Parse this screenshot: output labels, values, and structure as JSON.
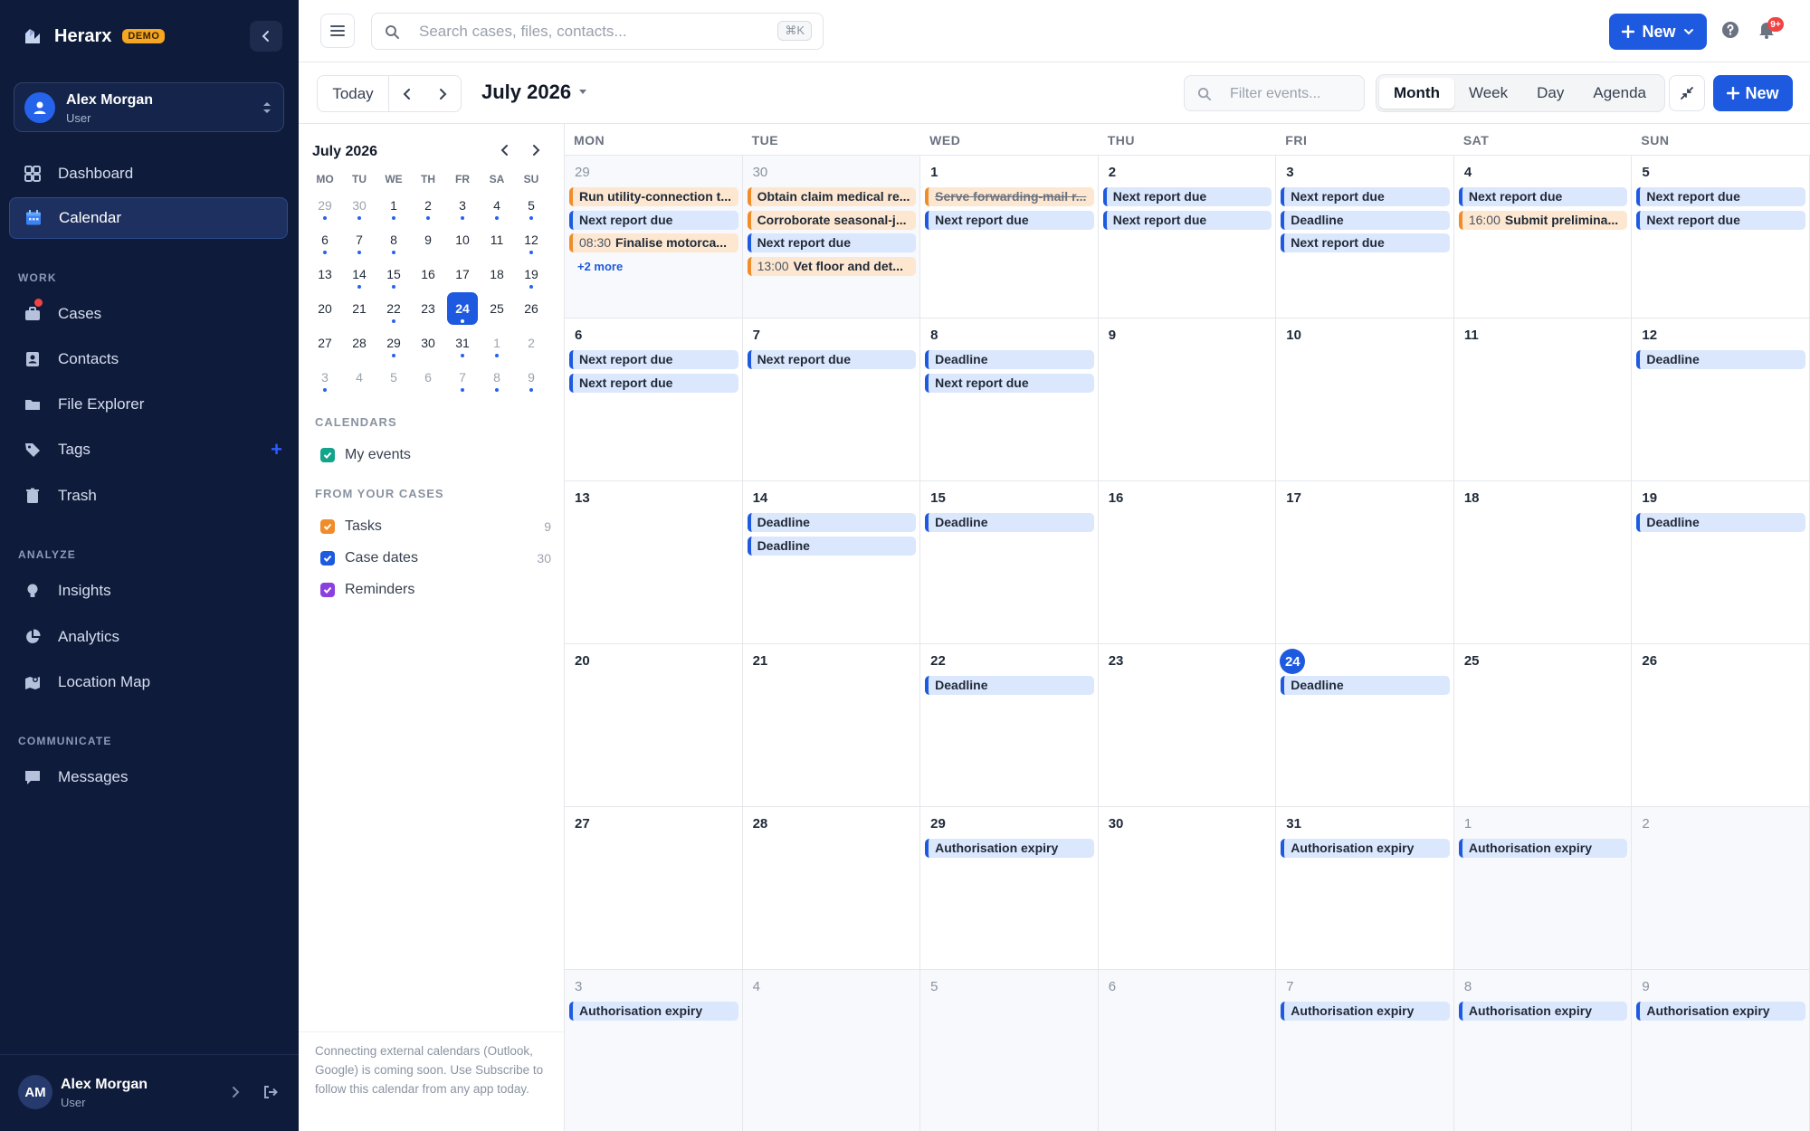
{
  "brand": {
    "name": "Herarx",
    "badge": "DEMO"
  },
  "user": {
    "name": "Alex Morgan",
    "role": "User",
    "initials": "AM"
  },
  "nav": {
    "dashboard": "Dashboard",
    "calendar": "Calendar",
    "work_label": "WORK",
    "cases": "Cases",
    "contacts": "Contacts",
    "file_explorer": "File Explorer",
    "tags": "Tags",
    "tags_add": "+",
    "trash": "Trash",
    "analyze_label": "ANALYZE",
    "insights": "Insights",
    "analytics": "Analytics",
    "location_map": "Location Map",
    "communicate_label": "COMMUNICATE",
    "messages": "Messages"
  },
  "topbar": {
    "search_placeholder": "Search cases, files, contacts...",
    "shortcut": "⌘K",
    "new_label": "New",
    "notif_badge": "9+"
  },
  "toolbar": {
    "today": "Today",
    "period": "July 2026",
    "filter_placeholder": "Filter events...",
    "views": [
      "Month",
      "Week",
      "Day",
      "Agenda"
    ],
    "active_view": "Month",
    "new_label": "New"
  },
  "mini_calendar": {
    "title": "July 2026",
    "weekdays": [
      "MO",
      "TU",
      "WE",
      "TH",
      "FR",
      "SA",
      "SU"
    ],
    "weeks": [
      [
        {
          "d": "29",
          "out": true,
          "dot": true
        },
        {
          "d": "30",
          "out": true,
          "dot": true
        },
        {
          "d": "1",
          "dot": true
        },
        {
          "d": "2",
          "dot": true
        },
        {
          "d": "3",
          "dot": true
        },
        {
          "d": "4",
          "dot": true
        },
        {
          "d": "5",
          "dot": true
        }
      ],
      [
        {
          "d": "6",
          "dot": true
        },
        {
          "d": "7",
          "dot": true
        },
        {
          "d": "8",
          "dot": true
        },
        {
          "d": "9"
        },
        {
          "d": "10"
        },
        {
          "d": "11"
        },
        {
          "d": "12",
          "dot": true
        }
      ],
      [
        {
          "d": "13"
        },
        {
          "d": "14",
          "dot": true
        },
        {
          "d": "15",
          "dot": true
        },
        {
          "d": "16"
        },
        {
          "d": "17"
        },
        {
          "d": "18"
        },
        {
          "d": "19",
          "dot": true
        }
      ],
      [
        {
          "d": "20"
        },
        {
          "d": "21"
        },
        {
          "d": "22",
          "dot": true
        },
        {
          "d": "23"
        },
        {
          "d": "24",
          "sel": true,
          "dot": true
        },
        {
          "d": "25"
        },
        {
          "d": "26"
        }
      ],
      [
        {
          "d": "27"
        },
        {
          "d": "28"
        },
        {
          "d": "29",
          "dot": true
        },
        {
          "d": "30"
        },
        {
          "d": "31",
          "dot": true
        },
        {
          "d": "1",
          "out": true,
          "dot": true
        },
        {
          "d": "2",
          "out": true
        }
      ],
      [
        {
          "d": "3",
          "out": true,
          "dot": true
        },
        {
          "d": "4",
          "out": true
        },
        {
          "d": "5",
          "out": true
        },
        {
          "d": "6",
          "out": true
        },
        {
          "d": "7",
          "out": true,
          "dot": true
        },
        {
          "d": "8",
          "out": true,
          "dot": true
        },
        {
          "d": "9",
          "out": true,
          "dot": true
        }
      ]
    ]
  },
  "calendars": {
    "section_label": "CALENDARS",
    "my_events": "My events",
    "cases_label": "FROM YOUR CASES",
    "tasks": "Tasks",
    "tasks_count": "9",
    "case_dates": "Case dates",
    "case_dates_count": "30",
    "reminders": "Reminders",
    "colors": {
      "my_events": "#14a38b",
      "tasks": "#f08c2a",
      "case_dates": "#1d5ae0",
      "reminders": "#8b3fe0"
    }
  },
  "footer_note": "Connecting external calendars (Outlook, Google) is coming soon. Use Subscribe to follow this calendar from any app today.",
  "month": {
    "weekdays": [
      "MON",
      "TUE",
      "WED",
      "THU",
      "FRI",
      "SAT",
      "SUN"
    ],
    "weeks": [
      [
        {
          "d": "29",
          "out": true,
          "events": [
            {
              "t": "Run utility-connection t...",
              "c": "orange"
            },
            {
              "t": "Next report due",
              "c": "blue"
            },
            {
              "time": "08:30",
              "t": "Finalise motorca...",
              "c": "orange"
            }
          ],
          "more": "+2 more"
        },
        {
          "d": "30",
          "out": true,
          "events": [
            {
              "t": "Obtain claim medical re...",
              "c": "orange"
            },
            {
              "t": "Corroborate seasonal-j...",
              "c": "orange"
            },
            {
              "t": "Next report due",
              "c": "blue"
            },
            {
              "time": "13:00",
              "t": "Vet floor and det...",
              "c": "orange"
            }
          ]
        },
        {
          "d": "1",
          "events": [
            {
              "t": "Serve forwarding-mail r...",
              "c": "orange",
              "strike": true
            },
            {
              "t": "Next report due",
              "c": "blue"
            }
          ]
        },
        {
          "d": "2",
          "events": [
            {
              "t": "Next report due",
              "c": "blue"
            },
            {
              "t": "Next report due",
              "c": "blue"
            }
          ]
        },
        {
          "d": "3",
          "events": [
            {
              "t": "Next report due",
              "c": "blue"
            },
            {
              "t": "Deadline",
              "c": "blue"
            },
            {
              "t": "Next report due",
              "c": "blue"
            }
          ]
        },
        {
          "d": "4",
          "events": [
            {
              "t": "Next report due",
              "c": "blue"
            },
            {
              "time": "16:00",
              "t": "Submit prelimina...",
              "c": "orange"
            }
          ]
        },
        {
          "d": "5",
          "events": [
            {
              "t": "Next report due",
              "c": "blue"
            },
            {
              "t": "Next report due",
              "c": "blue"
            }
          ]
        }
      ],
      [
        {
          "d": "6",
          "events": [
            {
              "t": "Next report due",
              "c": "blue"
            },
            {
              "t": "Next report due",
              "c": "blue"
            }
          ]
        },
        {
          "d": "7",
          "events": [
            {
              "t": "Next report due",
              "c": "blue"
            }
          ]
        },
        {
          "d": "8",
          "events": [
            {
              "t": "Deadline",
              "c": "blue"
            },
            {
              "t": "Next report due",
              "c": "blue"
            }
          ]
        },
        {
          "d": "9",
          "events": []
        },
        {
          "d": "10",
          "events": []
        },
        {
          "d": "11",
          "events": []
        },
        {
          "d": "12",
          "events": [
            {
              "t": "Deadline",
              "c": "blue"
            }
          ]
        }
      ],
      [
        {
          "d": "13",
          "events": []
        },
        {
          "d": "14",
          "events": [
            {
              "t": "Deadline",
              "c": "blue"
            },
            {
              "t": "Deadline",
              "c": "blue"
            }
          ]
        },
        {
          "d": "15",
          "events": [
            {
              "t": "Deadline",
              "c": "blue"
            }
          ]
        },
        {
          "d": "16",
          "events": []
        },
        {
          "d": "17",
          "events": []
        },
        {
          "d": "18",
          "events": []
        },
        {
          "d": "19",
          "events": [
            {
              "t": "Deadline",
              "c": "blue"
            }
          ]
        }
      ],
      [
        {
          "d": "20",
          "events": []
        },
        {
          "d": "21",
          "events": []
        },
        {
          "d": "22",
          "events": [
            {
              "t": "Deadline",
              "c": "blue"
            }
          ]
        },
        {
          "d": "23",
          "events": []
        },
        {
          "d": "24",
          "today": true,
          "events": [
            {
              "t": "Deadline",
              "c": "blue"
            }
          ]
        },
        {
          "d": "25",
          "events": []
        },
        {
          "d": "26",
          "events": []
        }
      ],
      [
        {
          "d": "27",
          "events": []
        },
        {
          "d": "28",
          "events": []
        },
        {
          "d": "29",
          "events": [
            {
              "t": "Authorisation expiry",
              "c": "blue"
            }
          ]
        },
        {
          "d": "30",
          "events": []
        },
        {
          "d": "31",
          "events": [
            {
              "t": "Authorisation expiry",
              "c": "blue"
            }
          ]
        },
        {
          "d": "1",
          "out": true,
          "events": [
            {
              "t": "Authorisation expiry",
              "c": "blue"
            }
          ]
        },
        {
          "d": "2",
          "out": true,
          "events": []
        }
      ],
      [
        {
          "d": "3",
          "out": true,
          "events": [
            {
              "t": "Authorisation expiry",
              "c": "blue"
            }
          ]
        },
        {
          "d": "4",
          "out": true,
          "events": []
        },
        {
          "d": "5",
          "out": true,
          "events": []
        },
        {
          "d": "6",
          "out": true,
          "events": []
        },
        {
          "d": "7",
          "out": true,
          "events": [
            {
              "t": "Authorisation expiry",
              "c": "blue"
            }
          ]
        },
        {
          "d": "8",
          "out": true,
          "events": [
            {
              "t": "Authorisation expiry",
              "c": "blue"
            }
          ]
        },
        {
          "d": "9",
          "out": true,
          "events": [
            {
              "t": "Authorisation expiry",
              "c": "blue"
            }
          ]
        }
      ]
    ]
  }
}
